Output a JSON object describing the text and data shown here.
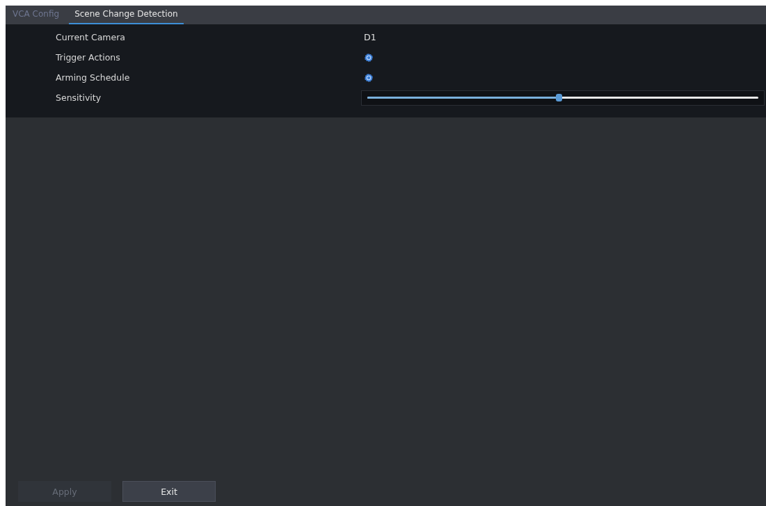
{
  "tabs": [
    {
      "label": "VCA Config",
      "selected": false
    },
    {
      "label": "Scene Change Detection",
      "selected": true
    }
  ],
  "settings": [
    {
      "kind": "text",
      "label": "Current Camera",
      "value": "D1"
    },
    {
      "kind": "gear",
      "label": "Trigger Actions"
    },
    {
      "kind": "gear",
      "label": "Arming Schedule"
    },
    {
      "kind": "slider",
      "label": "Sensitivity",
      "level": 0.49
    }
  ],
  "buttons": [
    {
      "label": "Apply",
      "disabled": true
    },
    {
      "label": "Exit",
      "disabled": false
    }
  ]
}
